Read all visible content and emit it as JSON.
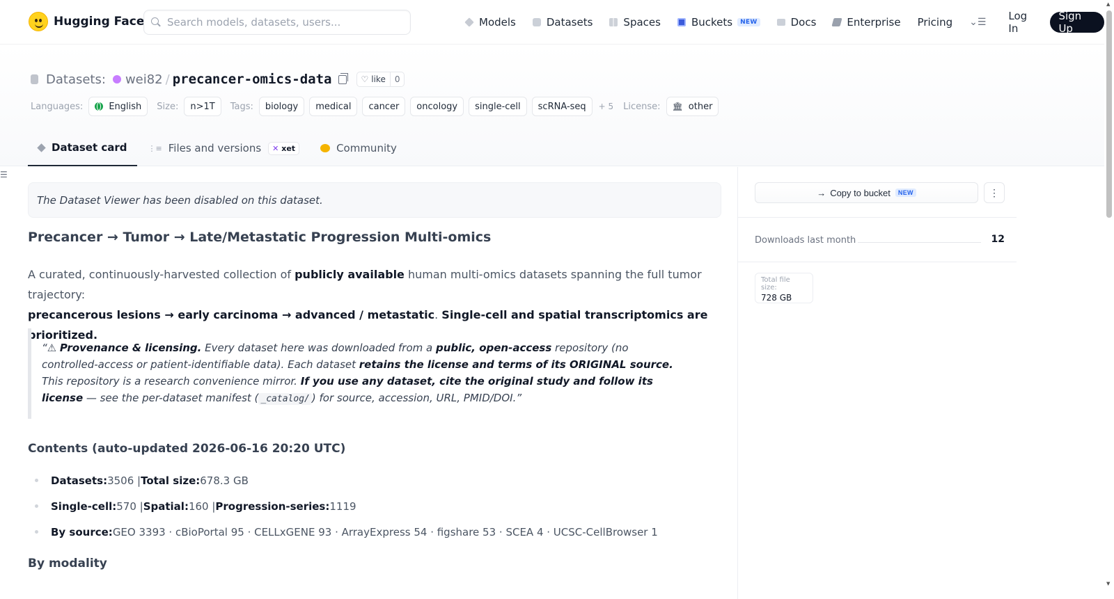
{
  "nav": {
    "brand": "Hugging Face",
    "search_placeholder": "Search models, datasets, users...",
    "links": {
      "models": "Models",
      "datasets": "Datasets",
      "spaces": "Spaces",
      "buckets": "Buckets",
      "buckets_badge": "NEW",
      "docs": "Docs",
      "enterprise": "Enterprise",
      "pricing": "Pricing"
    },
    "login": "Log In",
    "signup": "Sign Up"
  },
  "repo": {
    "type_label": "Datasets:",
    "owner": "wei82",
    "separator": "/",
    "name": "precancer-omics-data",
    "like_label": "like",
    "like_count": "0"
  },
  "tags": {
    "languages_label": "Languages:",
    "language": "English",
    "size_label": "Size:",
    "size": "n>1T",
    "tags_label": "Tags:",
    "items": [
      "biology",
      "medical",
      "cancer",
      "oncology",
      "single-cell",
      "scRNA-seq"
    ],
    "more": "+ 5",
    "license_label": "License:",
    "license": "other"
  },
  "tabs": {
    "card": "Dataset card",
    "files": "Files and versions",
    "xet": "xet",
    "community": "Community"
  },
  "content": {
    "viewer_notice": "The Dataset Viewer has been disabled on this dataset.",
    "heading": "Precancer → Tumor → Late/Metastatic Progression Multi-omics",
    "intro_1": "A curated, continuously-harvested collection of ",
    "intro_bold_1": "publicly available",
    "intro_2": " human multi-omics datasets spanning the full tumor trajectory:",
    "intro_bold_2": "precancerous lesions → early carcinoma → advanced / metastatic",
    "intro_3": ". ",
    "intro_bold_3": "Single-cell and spatial transcriptomics are prioritized.",
    "quote": {
      "open": "“⚠ ",
      "b1": "Provenance & licensing.",
      "t1": " Every dataset here was downloaded from a ",
      "b2": "public, open-access",
      "t2": " repository (no controlled-access or patient-identifiable data). Each dataset ",
      "b3": "retains the license and terms of its ORIGINAL source.",
      "t3": " This repository is a research convenience mirror. ",
      "b4": "If you use any dataset, cite the original study and follow its license",
      "t4": " — see the per-dataset manifest (",
      "code": "_catalog/",
      "t5": ") for source, accession, URL, PMID/DOI.”"
    },
    "contents_heading": "Contents (auto-updated 2026-06-16 20:20 UTC)",
    "stats": {
      "datasets_label": "Datasets:",
      "datasets_val": " 3506 | ",
      "total_label": "Total size:",
      "total_val": " 678.3 GB",
      "single_label": "Single-cell:",
      "single_val": " 570 | ",
      "spatial_label": "Spatial:",
      "spatial_val": " 160 | ",
      "prog_label": "Progression-series:",
      "prog_val": " 1119",
      "source_label": "By source:",
      "source_val": " GEO 3393 · cBioPortal 95 · CELLxGENE 93 · ArrayExpress 54 · figshare 53 · SCEA 4 · UCSC-CellBrowser 1"
    },
    "modality_heading": "By modality"
  },
  "sidebar": {
    "copy_bucket": "Copy to bucket",
    "copy_bucket_badge": "NEW",
    "downloads_label": "Downloads last month",
    "downloads_count": "12",
    "file_size_label": "Total file size:",
    "file_size": "728 GB"
  },
  "colors": {
    "brand_yellow": "#ffd21e",
    "signup_bg": "#0b1120",
    "new_badge": "#2563eb",
    "user_avatar": "#c77dff"
  }
}
